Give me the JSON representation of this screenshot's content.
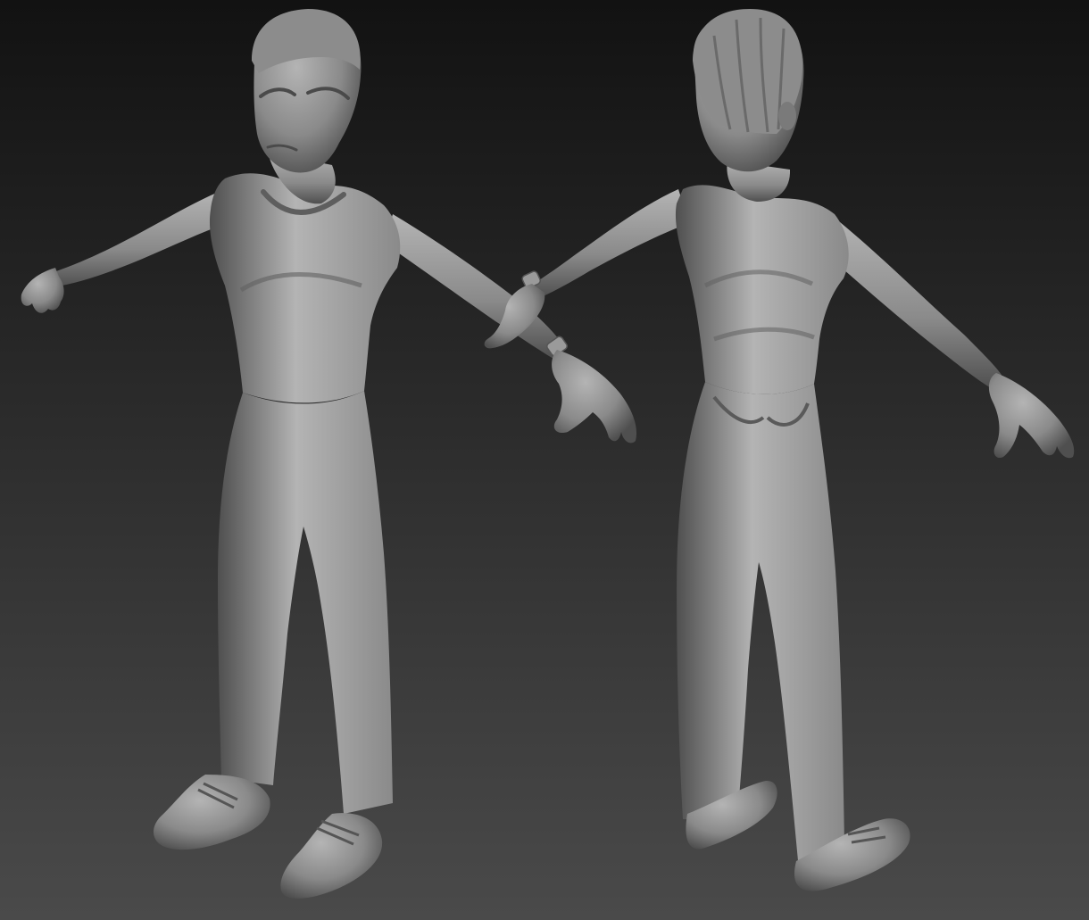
{
  "scene": {
    "render_style": "sculpt-viewport-clay",
    "background_top": "#121212",
    "background_bottom": "#4a4a4a",
    "clay_light": "#b4b4b4",
    "clay_mid": "#8a8a8a",
    "clay_dark": "#4f4f4f",
    "views": [
      {
        "name": "front-three-quarter-view"
      },
      {
        "name": "back-three-quarter-view"
      }
    ]
  }
}
